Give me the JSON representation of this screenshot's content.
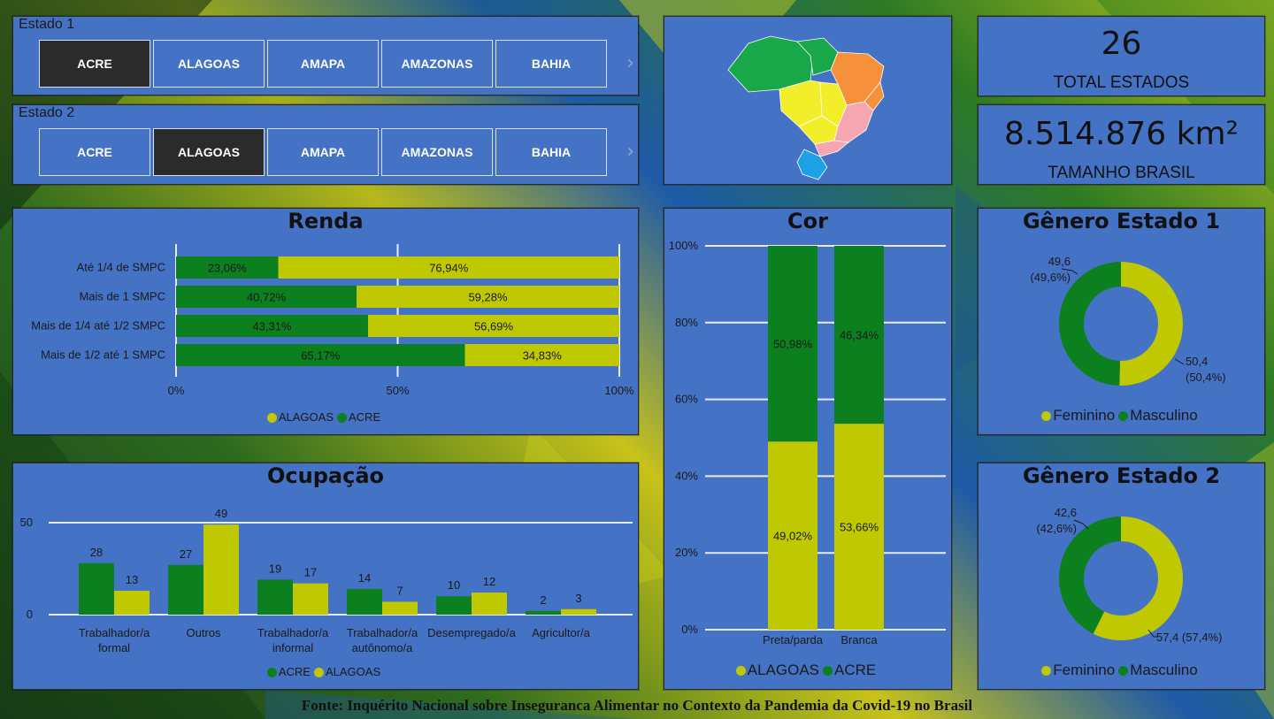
{
  "colors": {
    "alagoas": "#bfc800",
    "acre": "#0c7f1f",
    "panel": "#4472c4"
  },
  "slicer1": {
    "title": "Estado 1",
    "states": [
      "ACRE",
      "ALAGOAS",
      "AMAPA",
      "AMAZONAS",
      "BAHIA"
    ],
    "selected": "ACRE"
  },
  "slicer2": {
    "title": "Estado 2",
    "states": [
      "ACRE",
      "ALAGOAS",
      "AMAPA",
      "AMAZONAS",
      "BAHIA"
    ],
    "selected": "ALAGOAS"
  },
  "map": {
    "icon": "brazil-map-icon"
  },
  "kpi1": {
    "value": "26",
    "label": "TOTAL ESTADOS"
  },
  "kpi2": {
    "value": "8.514.876 km²",
    "label": "TAMANHO BRASIL"
  },
  "footer": "Fonte: Inquérito Nacional sobre Inseguranca Alimentar no Contexto da Pandemia da Covid-19 no Brasil",
  "chart_data": [
    {
      "id": "renda",
      "type": "bar",
      "title": "Renda",
      "orientation": "horizontal",
      "stacked": "100%",
      "categories": [
        "Até 1/4 de SMPC",
        "Mais de 1 SMPC",
        "Mais de 1/4 até 1/2 SMPC",
        "Mais de 1/2 até 1 SMPC"
      ],
      "series": [
        {
          "name": "ACRE",
          "values": [
            23.06,
            40.72,
            43.31,
            65.17
          ],
          "labels": [
            "23,06%",
            "40,72%",
            "43,31%",
            "65,17%"
          ]
        },
        {
          "name": "ALAGOAS",
          "values": [
            76.94,
            59.28,
            56.69,
            34.83
          ],
          "labels": [
            "76,94%",
            "59,28%",
            "56,69%",
            "34,83%"
          ]
        }
      ],
      "ticks": [
        "0%",
        "50%",
        "100%"
      ],
      "legend": [
        "ALAGOAS",
        "ACRE"
      ]
    },
    {
      "id": "ocupacao",
      "type": "bar",
      "title": "Ocupação",
      "categories": [
        [
          "Trabalhador/a",
          "formal"
        ],
        [
          "Outros"
        ],
        [
          "Trabalhador/a",
          "informal"
        ],
        [
          "Trabalhador/a",
          "autônomo/a"
        ],
        [
          "Desempregado/a"
        ],
        [
          "Agricultor/a"
        ]
      ],
      "series": [
        {
          "name": "ACRE",
          "values": [
            28,
            27,
            19,
            14,
            10,
            2
          ]
        },
        {
          "name": "ALAGOAS",
          "values": [
            13,
            49,
            17,
            7,
            12,
            3
          ]
        }
      ],
      "ticks": [
        "0",
        "50"
      ],
      "ylim": [
        0,
        50
      ],
      "legend": [
        "ACRE",
        "ALAGOAS"
      ]
    },
    {
      "id": "cor",
      "type": "bar",
      "title": "Cor",
      "orientation": "vertical",
      "stacked": "100%",
      "categories": [
        "Preta/parda",
        "Branca"
      ],
      "series": [
        {
          "name": "ALAGOAS",
          "values": [
            49.02,
            53.66
          ],
          "labels": [
            "49,02%",
            "53,66%"
          ]
        },
        {
          "name": "ACRE",
          "values": [
            50.98,
            46.34
          ],
          "labels": [
            "50,98%",
            "46,34%"
          ]
        }
      ],
      "ticks": [
        "0%",
        "20%",
        "40%",
        "60%",
        "80%",
        "100%"
      ],
      "legend": [
        "ALAGOAS",
        "ACRE"
      ]
    },
    {
      "id": "genero1",
      "type": "pie",
      "title": "Gênero Estado 1",
      "donut": true,
      "slices": [
        {
          "name": "Feminino",
          "value": 50.4,
          "label": [
            "50,4",
            "(50,4%)"
          ]
        },
        {
          "name": "Masculino",
          "value": 49.6,
          "label": [
            "49,6",
            "(49,6%)"
          ]
        }
      ],
      "legend": [
        "Feminino",
        "Masculino"
      ]
    },
    {
      "id": "genero2",
      "type": "pie",
      "title": "Gênero Estado 2",
      "donut": true,
      "slices": [
        {
          "name": "Feminino",
          "value": 57.4,
          "label": [
            "57,4 (57,4%)"
          ]
        },
        {
          "name": "Masculino",
          "value": 42.6,
          "label": [
            "42,6",
            "(42,6%)"
          ]
        }
      ],
      "legend": [
        "Feminino",
        "Masculino"
      ]
    }
  ]
}
